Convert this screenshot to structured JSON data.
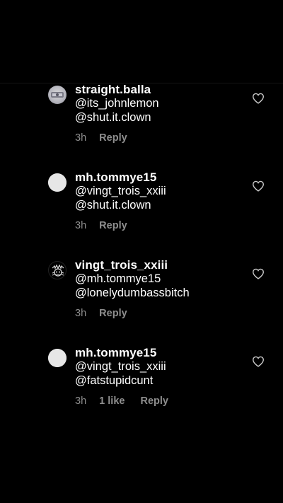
{
  "comments": [
    {
      "username": "straight.balla",
      "line1": "@its_johnlemon",
      "line2": "@shut.it.clown",
      "time": "3h",
      "likes": "",
      "reply": "Reply",
      "avatar": "photo-avatar"
    },
    {
      "username": "mh.tommye15",
      "line1": "@vingt_trois_xxiii",
      "line2": "@shut.it.clown",
      "time": "3h",
      "likes": "",
      "reply": "Reply",
      "avatar": "default-avatar"
    },
    {
      "username": "vingt_trois_xxiii",
      "line1": "@mh.tommye15",
      "line2": "@lonelydumbassbitch",
      "time": "3h",
      "likes": "",
      "reply": "Reply",
      "avatar": "badge-avatar"
    },
    {
      "username": "mh.tommye15",
      "line1": "@vingt_trois_xxiii",
      "line2": "@fatstupidcunt",
      "time": "3h",
      "likes": "1 like",
      "reply": "Reply",
      "avatar": "default-avatar"
    }
  ],
  "icons": {
    "like": "heart-outline-icon"
  },
  "colors": {
    "background": "#000000",
    "text": "#ffffff",
    "meta": "#8e8e8e"
  }
}
